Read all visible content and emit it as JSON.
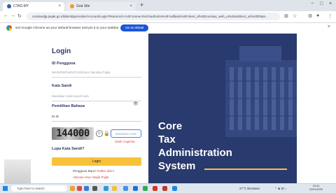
{
  "browser": {
    "tabs": [
      {
        "label": "CTAS-MY",
        "favicon_color": "#2c5fb5",
        "close": "×"
      },
      {
        "label": "Goá Site",
        "favicon_color": "#f09a2a",
        "close": "×"
      }
    ],
    "new_tab": "+",
    "window_controls": [
      "−",
      "□",
      "×"
    ],
    "address": "coretaxdjp.pajak.go.id/identityprovider/Account/Login?ReturnUrl=%2Fconnect%2Fauthorize%2Fcallback%3Fclient_id%3Dcoretax_web_ui%26redirect_uri%3Dhttps...",
    "infobar": {
      "message": "Set Google Chrome as your default browser and pin it to your taskbar",
      "default_button": "Set as default",
      "close": "×"
    }
  },
  "login": {
    "title": "Login",
    "id_label": "ID Pengguna",
    "id_placeholder": "NIK/NPWP16/NITKU/Nomor Identitas Pajak",
    "password_label": "Kata Sandi",
    "password_placeholder": "Masukkan Kata Sandi Anda",
    "language_label": "Pemilihan Bahasa",
    "language_value": "ID ID",
    "captcha_text": "144000",
    "captcha_placeholder": "Masukkan Kode",
    "captcha_link": "Ubah Captcha",
    "forgot": "Lupa Kata Sandi?",
    "login_button": "Login",
    "register_text": "Pengguna Baru?",
    "register_link": "Daftar disini",
    "activation_link": "Aktivasi Akun Wajib Pajak"
  },
  "hero": {
    "words": [
      "Core",
      "Tax",
      "Administration",
      "System"
    ],
    "bg_color": "#283a6e",
    "accent": "#f7c23a"
  },
  "taskbar": {
    "search_placeholder": "Type here to search",
    "weather": "27°C Berawan",
    "time": "20:44",
    "date": "24/01/2025"
  }
}
